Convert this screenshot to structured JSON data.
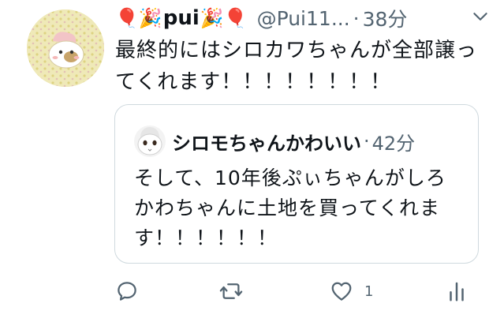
{
  "tweet": {
    "emoji_left": "🎈🎉",
    "display_name": "pui",
    "emoji_right": "🎉🎈",
    "handle": "@Pui11...",
    "separator": "·",
    "time": "38分",
    "text": "最終的にはシロカワちゃんが全部譲ってくれます！！！！！！！！"
  },
  "quote": {
    "display_name": "シロモちゃんかわいい",
    "separator": "·",
    "time": "42分",
    "text": "そして、10年後ぷぃちゃんがしろかわちゃんに土地を買ってくれます！！！！！！"
  },
  "actions": {
    "reply_icon": "reply-icon",
    "retweet_icon": "retweet-icon",
    "like_icon": "heart-icon",
    "like_count": "1",
    "analytics_icon": "analytics-icon"
  },
  "colors": {
    "text": "#0f1419",
    "secondary": "#536471",
    "border": "#cfd9de"
  }
}
